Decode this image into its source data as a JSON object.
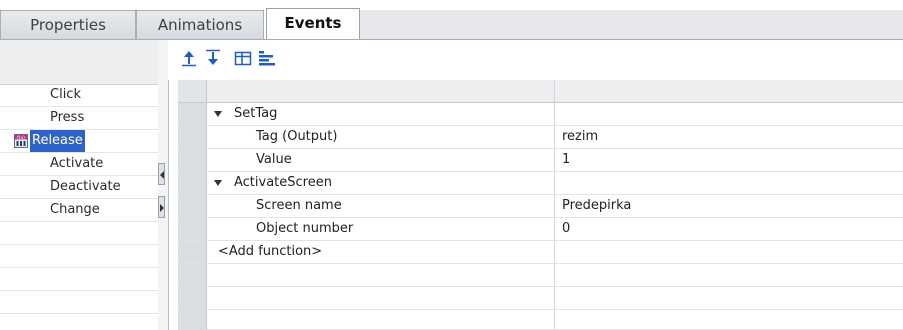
{
  "tabs": [
    {
      "label": "Properties",
      "active": false
    },
    {
      "label": "Animations",
      "active": false
    },
    {
      "label": "Events",
      "active": true
    }
  ],
  "events": [
    {
      "label": "Click",
      "selected": false
    },
    {
      "label": "Press",
      "selected": false
    },
    {
      "label": "Release",
      "selected": true
    },
    {
      "label": "Activate",
      "selected": false
    },
    {
      "label": "Deactivate",
      "selected": false
    },
    {
      "label": "Change",
      "selected": false
    }
  ],
  "toolbar": {
    "icons": [
      "move-up-icon",
      "move-down-icon",
      "expand-all-icon",
      "collapse-all-icon"
    ]
  },
  "grid": {
    "rows": [
      {
        "name": "SetTag",
        "value": "",
        "expandable": true,
        "indent": 1
      },
      {
        "name": "Tag (Output)",
        "value": "rezim",
        "expandable": false,
        "indent": 2
      },
      {
        "name": "Value",
        "value": "1",
        "expandable": false,
        "indent": 2
      },
      {
        "name": "ActivateScreen",
        "value": "",
        "expandable": true,
        "indent": 1
      },
      {
        "name": "Screen name",
        "value": "Predepirka",
        "expandable": false,
        "indent": 2
      },
      {
        "name": "Object number",
        "value": "0",
        "expandable": false,
        "indent": 2
      },
      {
        "name": "<Add function>",
        "value": "",
        "expandable": false,
        "indent": 0
      }
    ]
  },
  "colors": {
    "selection": "#2f64c6",
    "accent_icon": "#1f5fbf"
  }
}
